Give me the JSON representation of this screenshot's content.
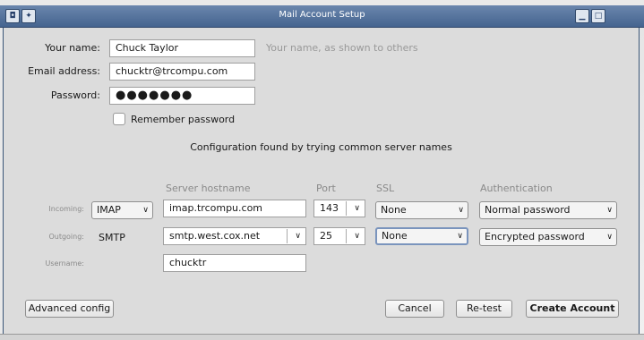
{
  "window": {
    "title": "Mail Account Setup",
    "menu_glyph": "◘",
    "pin_glyph": "✦",
    "min_glyph": "▁",
    "max_glyph": "□"
  },
  "form": {
    "name_label": "Your name:",
    "name_value": "Chuck Taylor",
    "name_hint": "Your name, as shown to others",
    "email_label": "Email address:",
    "email_value": "chucktr@trcompu.com",
    "password_label": "Password:",
    "password_value": "●●●●●●●",
    "remember_label": "Remember password"
  },
  "status": "Configuration found by trying common server names",
  "server_table": {
    "headers": {
      "hostname": "Server hostname",
      "port": "Port",
      "ssl": "SSL",
      "auth": "Authentication"
    },
    "incoming": {
      "label": "Incoming:",
      "protocol": "IMAP",
      "hostname": "imap.trcompu.com",
      "port": "143",
      "ssl": "None",
      "auth": "Normal password"
    },
    "outgoing": {
      "label": "Outgoing:",
      "protocol": "SMTP",
      "hostname": "smtp.west.cox.net",
      "port": "25",
      "ssl": "None",
      "auth": "Encrypted password"
    },
    "username": {
      "label": "Username:",
      "value": "chucktr"
    }
  },
  "buttons": {
    "advanced": "Advanced config",
    "cancel": "Cancel",
    "retest": "Re-test",
    "create": "Create Account"
  },
  "chevron": "∨"
}
